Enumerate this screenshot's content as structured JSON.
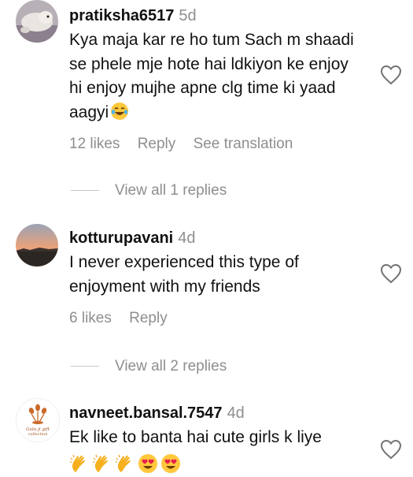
{
  "comments": [
    {
      "username": "pratiksha6517",
      "time": "5d",
      "text": "Kya maja kar re ho tum Sach m shaadi se phele mje hote hai ldkiyon ke enjoy hi enjoy mujhe apne clg time ki yaad aagyi",
      "emoji": "rolling-on-floor-laughing",
      "likes": "12 likes",
      "reply": "Reply",
      "translate": "See translation",
      "view_replies": "View all 1 replies"
    },
    {
      "username": "kotturupavani",
      "time": "4d",
      "text": "I never experienced this type of enjoyment with my friends",
      "likes": "6 likes",
      "reply": "Reply",
      "view_replies": "View all 2 replies"
    },
    {
      "username": "navneet.bansal.7547",
      "time": "4d",
      "text": "Ek like to banta hai cute girls k liye",
      "emojis": [
        "clapping-hands",
        "clapping-hands",
        "clapping-hands",
        "heart-eyes",
        "heart-eyes"
      ],
      "avatar_text": [
        "Gulu ji gift",
        "collection"
      ]
    }
  ],
  "icons": {
    "like": "heart-outline-icon"
  },
  "colors": {
    "secondary_text": "#8e8e8e",
    "primary_text": "#111111"
  }
}
